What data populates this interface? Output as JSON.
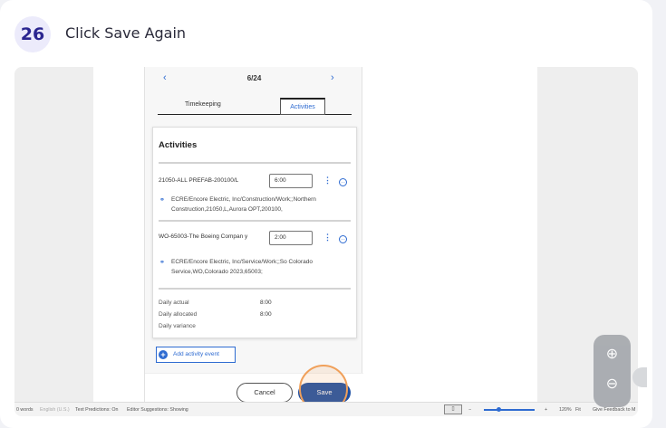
{
  "step": {
    "number": "26",
    "title": "Click Save Again"
  },
  "phone": {
    "pager": {
      "prev": "‹",
      "count": "6/24",
      "next": "›"
    },
    "tabs": [
      "Timekeeping",
      "Activities"
    ],
    "activities_title": "Activities",
    "entries": [
      {
        "name": "21050-ALL PREFAB-200100/L",
        "hours": "6:00",
        "path": "ECRE/Encore Electric, Inc/Construction/Work;;Northern Construction,21050,L,Aurora OPT,200100,"
      },
      {
        "name": "WO-65003-The Boeing Compan y",
        "hours": "2:00",
        "path": "ECRE/Encore Electric, Inc/Service/Work;;So Colorado Service,WO,Colorado 2023,65003;"
      }
    ],
    "daily": [
      {
        "label": "Daily actual",
        "value": "8:00"
      },
      {
        "label": "Daily allocated",
        "value": "8:00"
      },
      {
        "label": "Daily variance",
        "value": ""
      }
    ],
    "add_event": "Add activity event",
    "cancel": "Cancel",
    "save": "Save"
  },
  "status_bar": {
    "words": "0 words",
    "language": "English (U.S.)",
    "predictions": "Text Predictions: On",
    "editor": "Editor Suggestions: Showing",
    "zoom": "120%",
    "fit": "Fit",
    "feedback": "Give Feedback to M"
  },
  "colors": {
    "accent": "#2e6bd1",
    "badge_bg": "#ecebfb",
    "badge_fg": "#2b2690",
    "highlight": "#f0a05a"
  },
  "icons": [
    "zoom-in-icon",
    "zoom-out-icon",
    "link-icon",
    "more-icon",
    "info-icon",
    "plus-icon"
  ]
}
